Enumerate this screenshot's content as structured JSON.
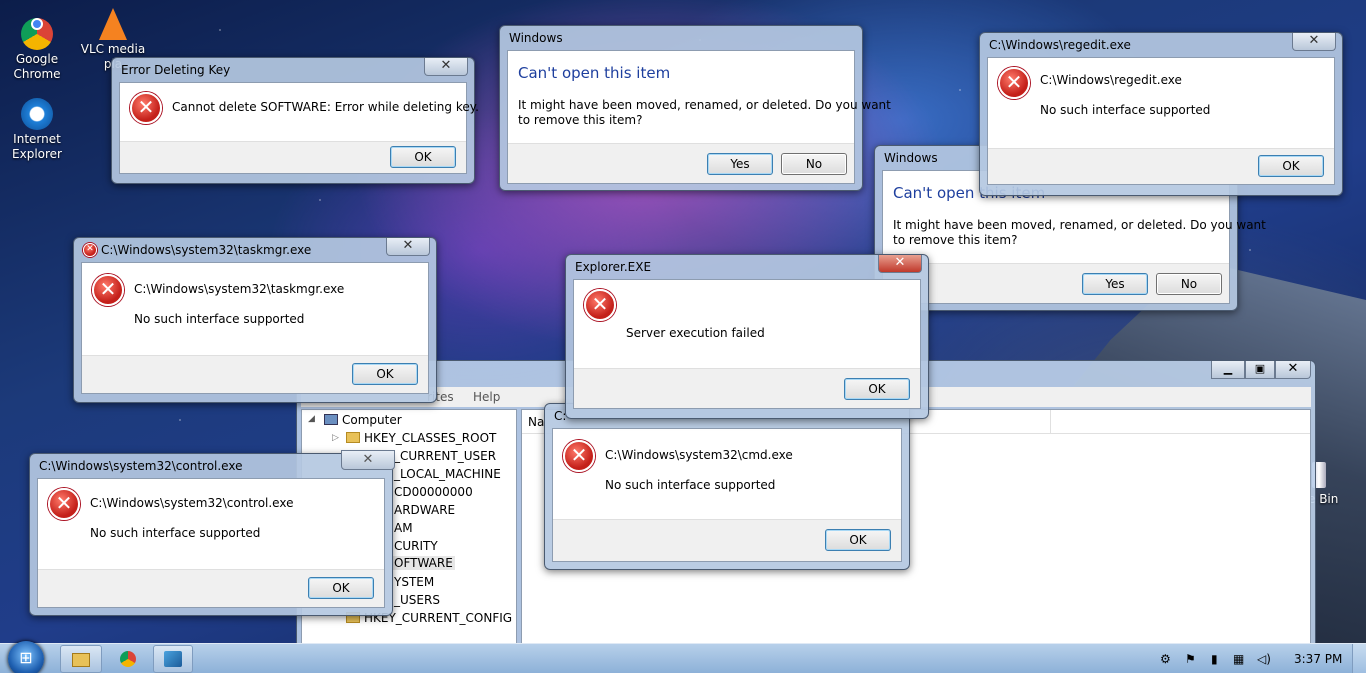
{
  "desktop": {
    "icons": [
      {
        "label": "Google Chrome"
      },
      {
        "label": "VLC media pla"
      },
      {
        "label": "Internet Explorer"
      },
      {
        "label": "e Bin"
      }
    ]
  },
  "dialogs": {
    "error_deleting": {
      "title": "Error Deleting Key",
      "message": "Cannot delete SOFTWARE:  Error while deleting key.",
      "ok": "OK",
      "close": "✕"
    },
    "cant_open_1": {
      "title": "Windows",
      "heading": "Can't open this item",
      "line1": "It might have been moved, renamed, or deleted. Do you want",
      "line2": "to remove this item?",
      "yes": "Yes",
      "no": "No"
    },
    "regedit_err": {
      "title": "C:\\Windows\\regedit.exe",
      "line1": "C:\\Windows\\regedit.exe",
      "line2": "No such interface supported",
      "ok": "OK",
      "close": "✕"
    },
    "cant_open_2": {
      "title": "Windows",
      "heading": "Can't open this item",
      "line1": "It might have been moved, renamed, or deleted. Do you want",
      "line2": "to remove this item?",
      "yes": "Yes",
      "no": "No"
    },
    "taskmgr_err": {
      "title": "C:\\Windows\\system32\\taskmgr.exe",
      "line1": "C:\\Windows\\system32\\taskmgr.exe",
      "line2": "No such interface supported",
      "ok": "OK",
      "close": "✕"
    },
    "explorer_err": {
      "title": "Explorer.EXE",
      "message": "Server execution failed",
      "ok": "OK",
      "close": "✕"
    },
    "control_err": {
      "title": "C:\\Windows\\system32\\control.exe",
      "line1": "C:\\Windows\\system32\\control.exe",
      "line2": "No such interface supported",
      "ok": "OK"
    },
    "cmd_err": {
      "title": "C:",
      "line1": "C:\\Windows\\system32\\cmd.exe",
      "line2": "No such interface supported",
      "ok": "OK"
    }
  },
  "regedit": {
    "menu": [
      "rites",
      "Help"
    ],
    "list_header": "Na",
    "tree": [
      "Computer",
      "HKEY_CLASSES_ROOT",
      "_CURRENT_USER",
      "_LOCAL_MACHINE",
      "CD00000000",
      "ARDWARE",
      "AM",
      "CURITY",
      "OFTWARE",
      "YSTEM",
      "_USERS",
      "HKEY_CURRENT_CONFIG"
    ]
  },
  "taskbar": {
    "time": "3:37 PM"
  }
}
